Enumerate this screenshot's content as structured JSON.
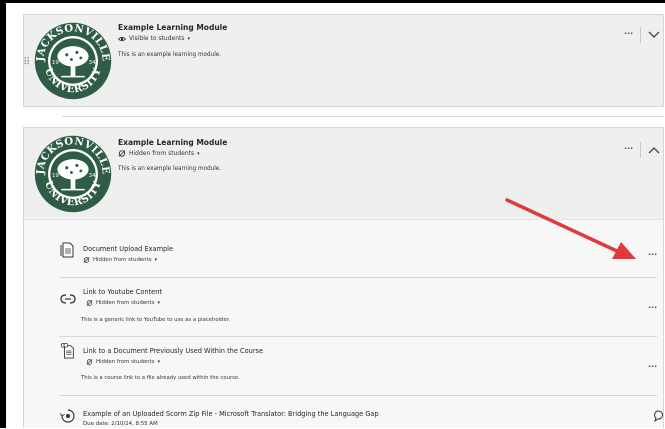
{
  "modules": [
    {
      "title": "Example Learning Module",
      "visibility": "Visible to students",
      "description": "This is an example learning module.",
      "expanded": false
    },
    {
      "title": "Example Learning Module",
      "visibility": "Hidden from students",
      "description": "This is an example learning module.",
      "expanded": true
    }
  ],
  "seal": {
    "top_text": "JACKSONVILLE",
    "bottom_text": "UNIVERSITY",
    "year_left": "19",
    "year_right": "34",
    "color": "#2e5c45"
  },
  "items": [
    {
      "title": "Document Upload Example",
      "status": "Hidden from students",
      "icon": "document-icon"
    },
    {
      "title": "Link to Youtube Content",
      "status": "Hidden from students",
      "description": "This is a generic link to YouTube to use as a placeholder.",
      "icon": "link-icon"
    },
    {
      "title": "Link to a Document Previously Used Within the Course",
      "status": "Hidden from students",
      "description": "This is a course link to a file already used within the course.",
      "icon": "course-link-document-icon"
    },
    {
      "title": "Example of an Uploaded Scorm Zip File - Microsoft Translator: Bridging the Language Gap",
      "status": "Due date: 2/10/24, 8:55 AM",
      "icon": "scorm-package-icon"
    }
  ],
  "colors": {
    "annotation_arrow": "#e03a3a",
    "module_background": "#efefef"
  }
}
